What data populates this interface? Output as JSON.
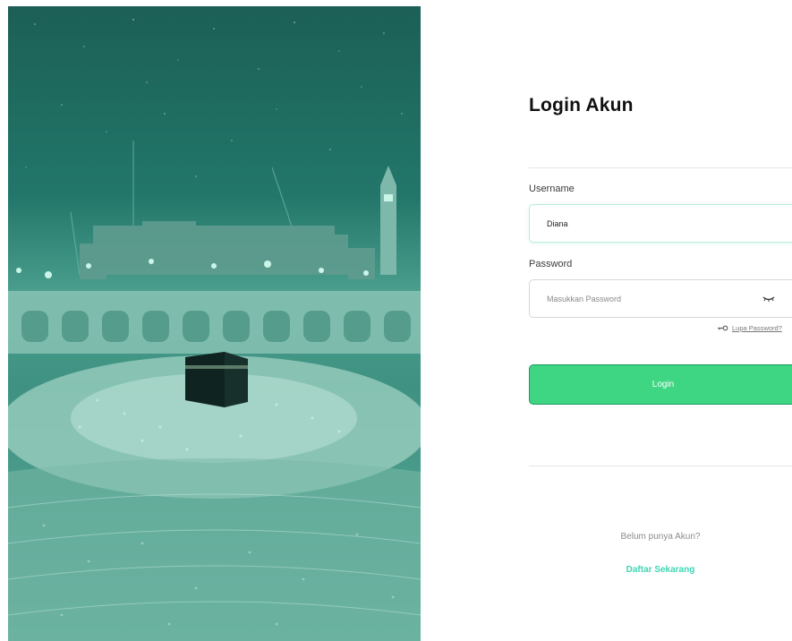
{
  "hero": {
    "image": "Masjid al-Haram with the Kaaba at night, green tinted"
  },
  "login": {
    "title": "Login Akun",
    "username": {
      "label": "Username",
      "value": "Diana"
    },
    "password": {
      "label": "Password",
      "placeholder": "Masukkan Password",
      "toggle_icon": "eye-closed-icon"
    },
    "forgot": {
      "icon": "key-icon",
      "label": "Lupa Password?"
    },
    "submit_label": "Login",
    "register": {
      "prompt": "Belum punya Akun?",
      "link_label": "Daftar Sekarang"
    }
  },
  "colors": {
    "accent": "#3ed583",
    "link": "#3fd6b4",
    "hero_tint": "#2a8a78"
  }
}
